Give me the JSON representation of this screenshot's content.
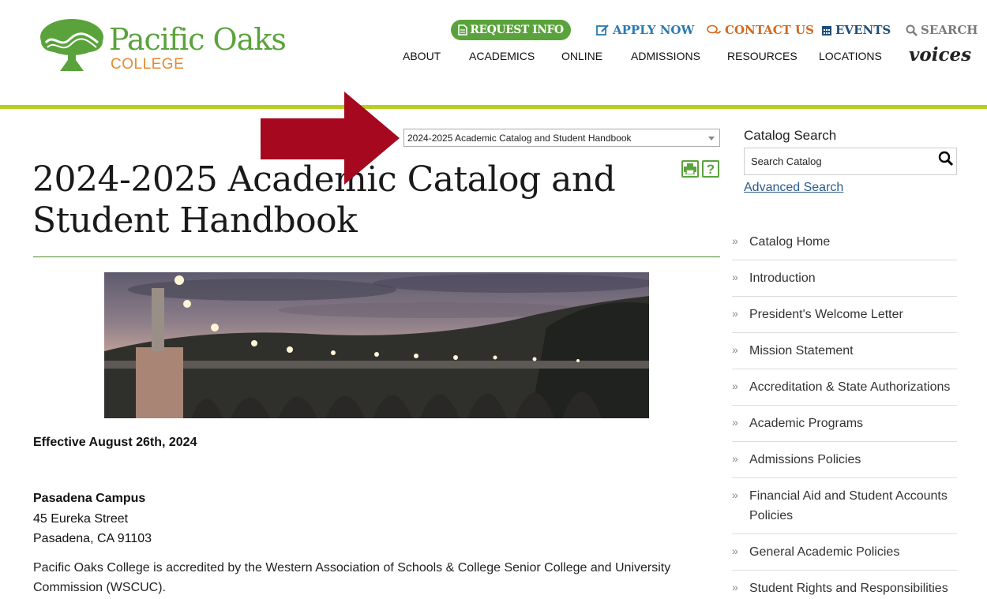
{
  "logo": {
    "title": "Pacific Oaks",
    "subtitle": "COLLEGE",
    "green": "#5aa33c",
    "orange": "#e78a30"
  },
  "utility_nav": {
    "request_info": "REQUEST INFO",
    "apply_now": "APPLY NOW",
    "contact_us": "CONTACT US",
    "events": "EVENTS",
    "search": "SEARCH"
  },
  "main_nav": [
    "ABOUT",
    "ACADEMICS",
    "ONLINE",
    "ADMISSIONS",
    "RESOURCES",
    "LOCATIONS"
  ],
  "voices_label": "voices",
  "catalog_select": {
    "selected": "2024-2025 Academic Catalog and Student Handbook"
  },
  "page": {
    "title": "2024-2025 Academic Catalog and Student Handbook",
    "effective": "Effective August 26th, 2024",
    "campus_name": "Pasadena Campus",
    "address_line1": "45 Eureka Street",
    "address_line2": "Pasadena, CA 91103",
    "accreditation": "Pacific Oaks College is accredited by the Western Association of Schools & College Senior College and University Commission (WSCUC)."
  },
  "sidebar": {
    "search_heading": "Catalog Search",
    "search_placeholder": "Search Catalog",
    "advanced_search": "Advanced Search",
    "items": [
      "Catalog Home",
      "Introduction",
      "President's Welcome Letter",
      "Mission Statement",
      "Accreditation & State Authorizations",
      "Academic Programs",
      "Admissions Policies",
      "Financial Aid and Student Accounts Policies",
      "General Academic Policies",
      "Student Rights and Responsibilities"
    ]
  },
  "colors": {
    "accent_green": "#5aa33c",
    "header_rule": "#b7cf1e",
    "apply_blue": "#2a7ab0",
    "contact_orange": "#d2691e",
    "events_navy": "#1f4e79",
    "arrow_red": "#a5081f"
  }
}
